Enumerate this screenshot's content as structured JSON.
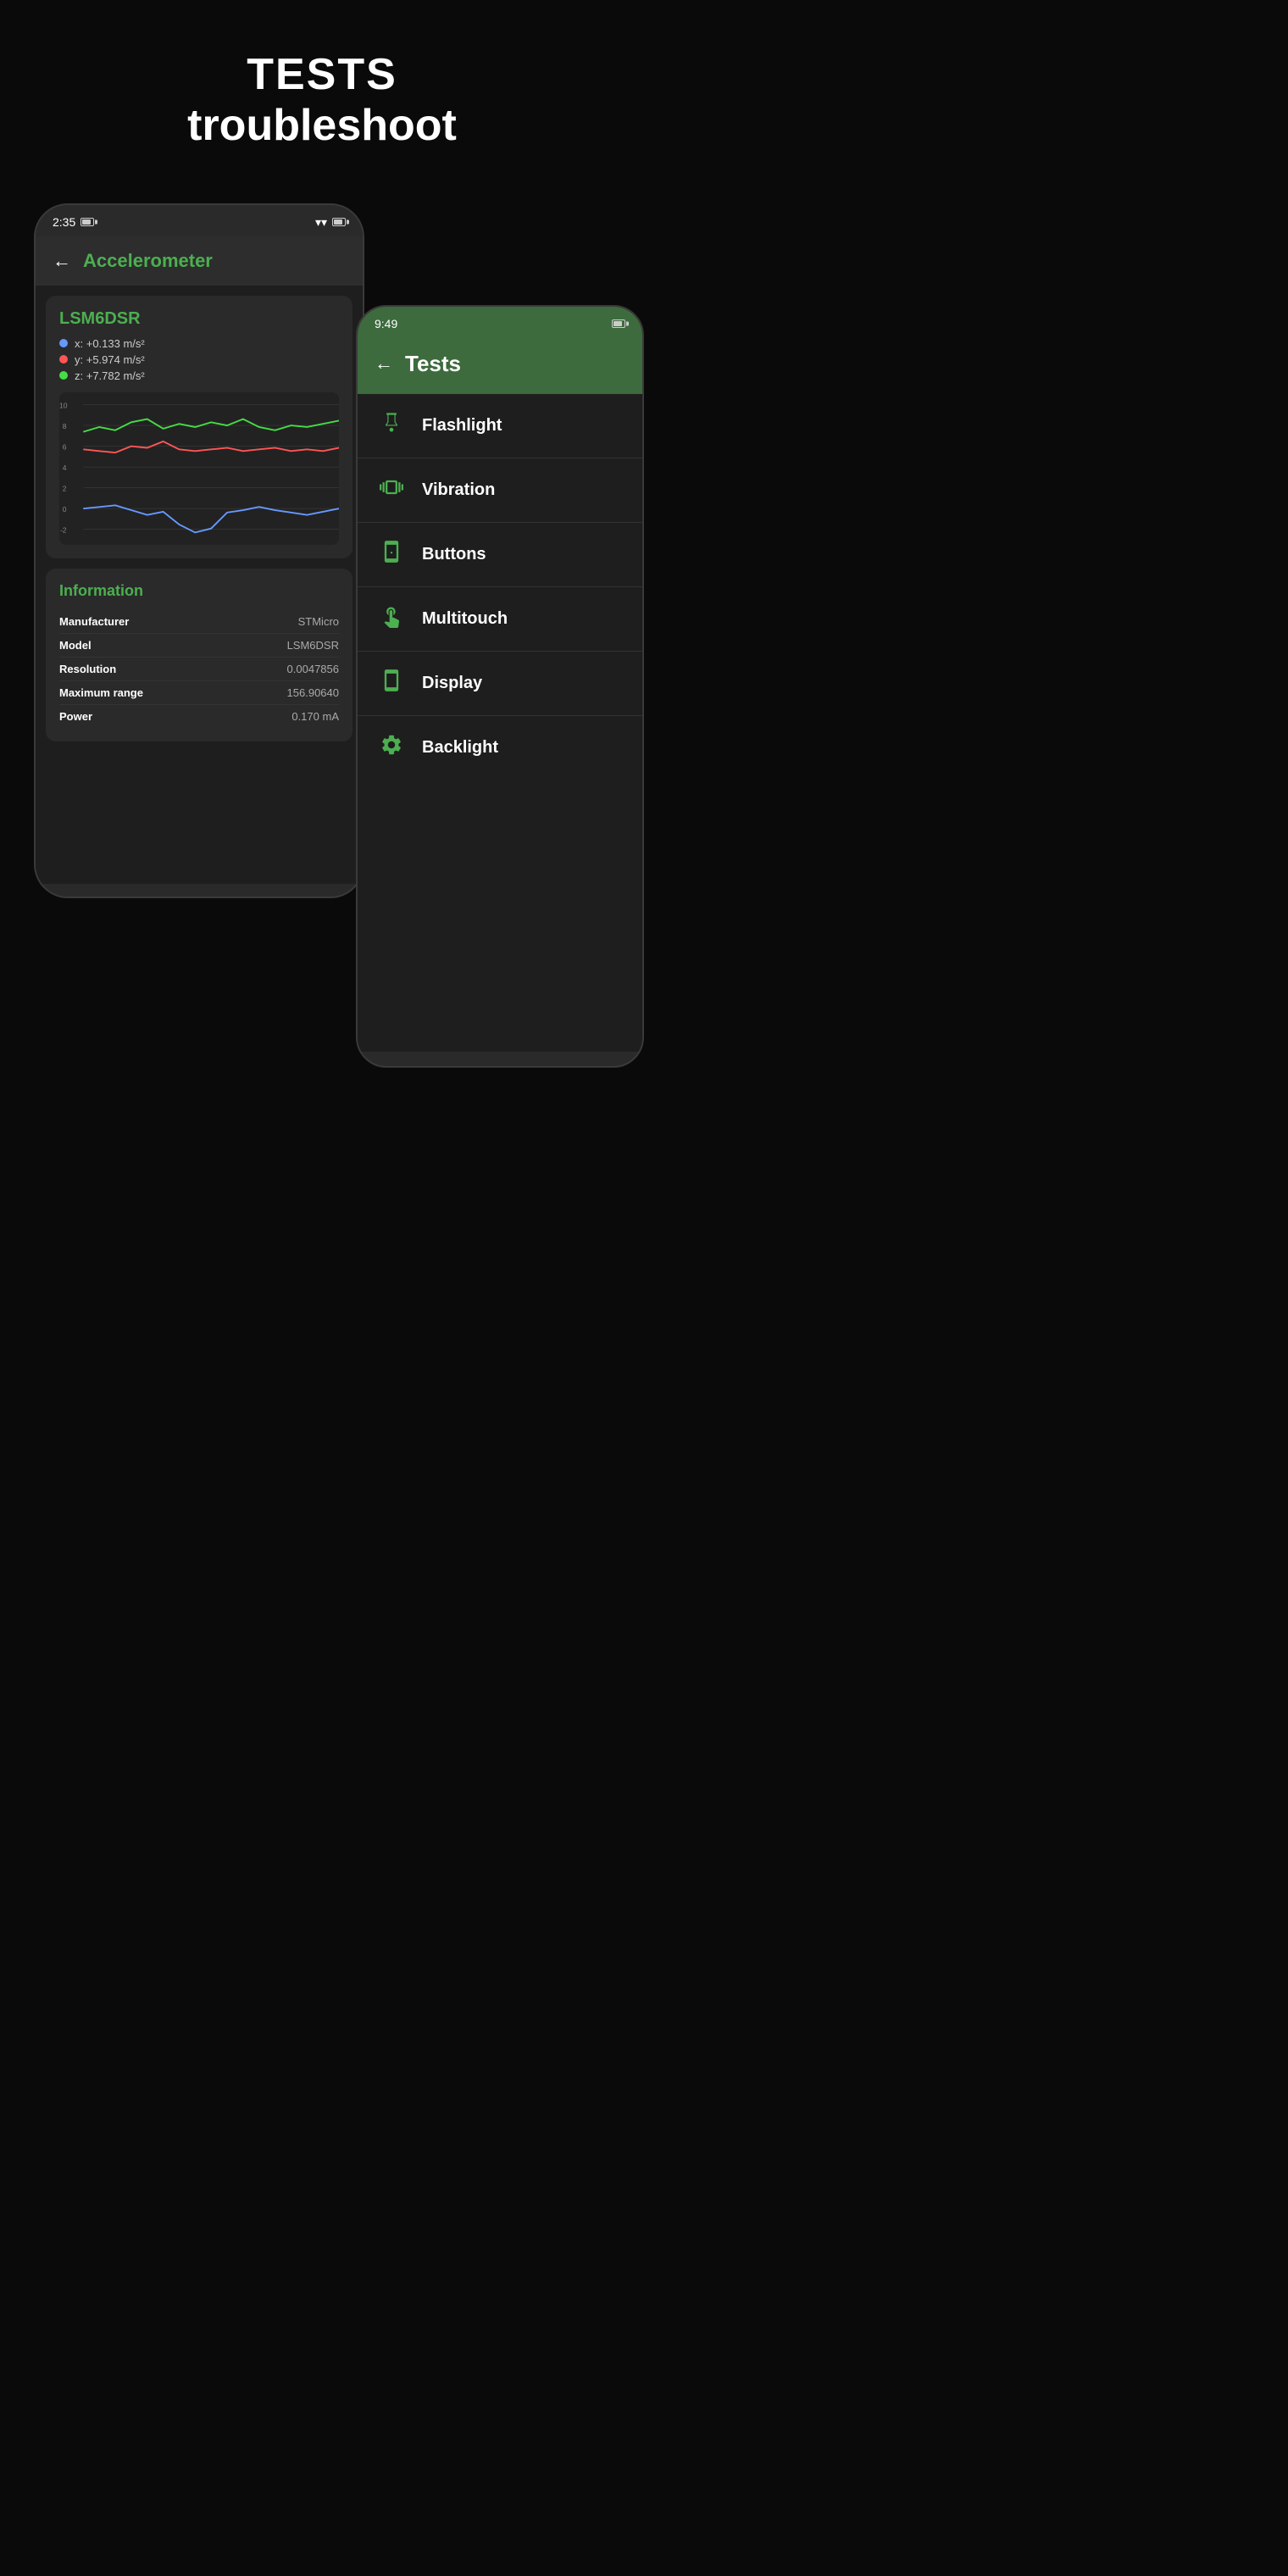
{
  "header": {
    "line1": "TESTS",
    "line2": "troubleshoot"
  },
  "phone_back": {
    "status": {
      "time": "2:35"
    },
    "app_bar": {
      "title": "Accelerometer"
    },
    "sensor_card": {
      "name": "LSM6DSR",
      "legend": [
        {
          "axis": "x",
          "value": "+0.133 m/s²",
          "color": "blue"
        },
        {
          "axis": "y",
          "value": "+5.974 m/s²",
          "color": "red"
        },
        {
          "axis": "z",
          "value": "+7.782 m/s²",
          "color": "green"
        }
      ],
      "chart": {
        "y_labels": [
          "10",
          "8",
          "6",
          "4",
          "2",
          "0",
          "-2"
        ]
      }
    },
    "info_card": {
      "title": "Information",
      "rows": [
        {
          "label": "Manufacturer",
          "value": "STMicro"
        },
        {
          "label": "Model",
          "value": "LSM6DSR"
        },
        {
          "label": "Resolution",
          "value": "0.0047856"
        },
        {
          "label": "Maximum range",
          "value": "156.90640"
        },
        {
          "label": "Power",
          "value": "0.170 mA"
        }
      ]
    }
  },
  "phone_front": {
    "status": {
      "time": "9:49"
    },
    "app_bar": {
      "title": "Tests"
    },
    "test_items": [
      {
        "id": "flashlight",
        "label": "Flashlight",
        "icon": "flashlight"
      },
      {
        "id": "vibration",
        "label": "Vibration",
        "icon": "vibration"
      },
      {
        "id": "buttons",
        "label": "Buttons",
        "icon": "buttons"
      },
      {
        "id": "multitouch",
        "label": "Multitouch",
        "icon": "multitouch"
      },
      {
        "id": "display",
        "label": "Display",
        "icon": "display"
      },
      {
        "id": "backlight",
        "label": "Backlight",
        "icon": "backlight"
      }
    ]
  }
}
